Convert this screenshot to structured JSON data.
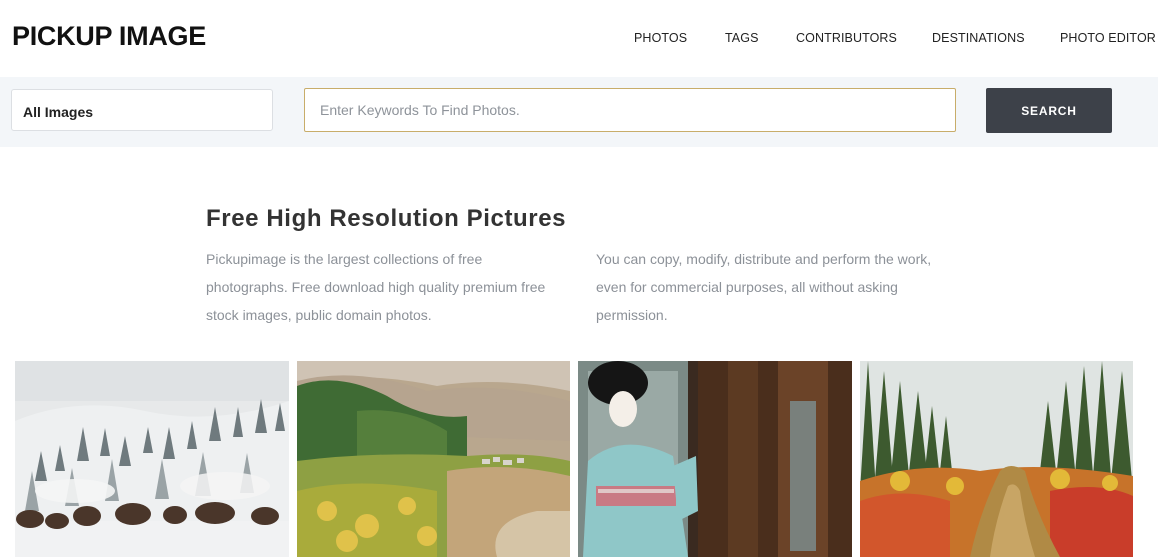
{
  "header": {
    "logo": "PICKUP IMAGE",
    "nav": [
      "PHOTOS",
      "TAGS",
      "CONTRIBUTORS",
      "DESTINATIONS",
      "PHOTO EDITOR"
    ]
  },
  "search": {
    "category_selected": "All Images",
    "placeholder": "Enter Keywords To Find Photos.",
    "button_label": "SEARCH"
  },
  "intro": {
    "title": "Free High Resolution Pictures",
    "col1_lines": [
      "Pickupimage is the largest collections of free",
      "photographs. Free download high quality premium free",
      "stock images, public domain photos."
    ],
    "col2_lines": [
      "You can copy, modify, distribute and perform the work,",
      "even for commercial purposes, all without asking",
      "permission."
    ]
  },
  "photos": [
    {
      "subject": "bison-in-snowy-forest"
    },
    {
      "subject": "autumn-valley-village"
    },
    {
      "subject": "geisha-in-kimono"
    },
    {
      "subject": "autumn-forest-creek"
    }
  ],
  "colors": {
    "accent_border": "#c8ad6a",
    "button_bg": "#3d4149",
    "band_bg": "#f3f6f9"
  }
}
